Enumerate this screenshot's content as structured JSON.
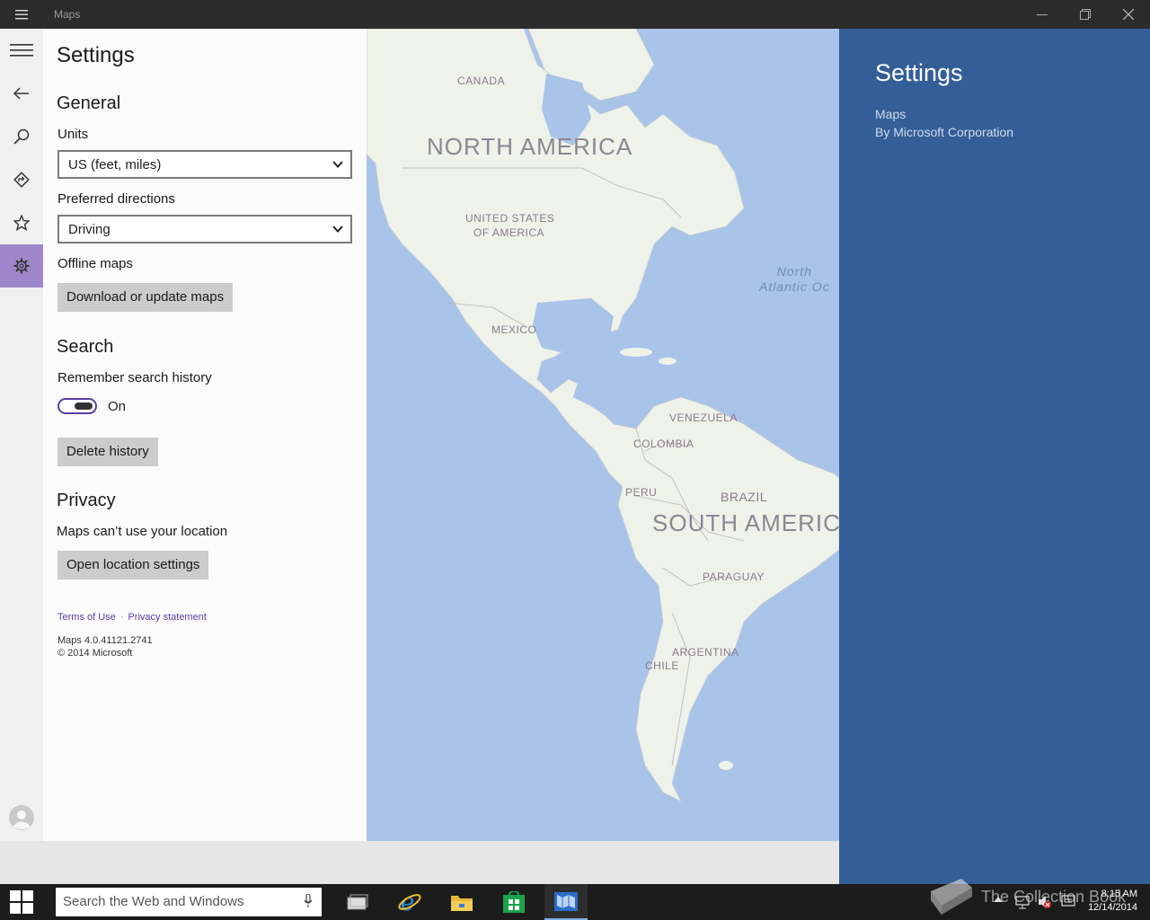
{
  "window": {
    "title": "Maps"
  },
  "settings": {
    "title": "Settings",
    "general": {
      "heading": "General",
      "units_label": "Units",
      "units_value": "US (feet, miles)",
      "directions_label": "Preferred directions",
      "directions_value": "Driving",
      "offline_label": "Offline maps",
      "download_button": "Download or update maps"
    },
    "search": {
      "heading": "Search",
      "history_label": "Remember search history",
      "toggle_state": "On",
      "delete_button": "Delete history"
    },
    "privacy": {
      "heading": "Privacy",
      "location_text": "Maps can’t use your location",
      "location_button": "Open location settings"
    },
    "links": {
      "terms": "Terms of Use",
      "sep": "·",
      "privacy": "Privacy statement"
    },
    "version": "Maps 4.0.41121.2741",
    "copyright": "© 2014 Microsoft"
  },
  "map_labels": {
    "canada": "CANADA",
    "north_america": "NORTH AMERICA",
    "usa_1": "UNITED STATES",
    "usa_2": "OF AMERICA",
    "mexico": "MEXICO",
    "venezuela": "VENEZUELA",
    "colombia": "COLOMBIA",
    "peru": "PERU",
    "brazil": "BRAZIL",
    "south_america": "SOUTH AMERICA",
    "paraguay": "PARAGUAY",
    "argentina": "ARGENTINA",
    "chile": "CHILE",
    "ocean_1": "North",
    "ocean_2": "Atlantic Oc"
  },
  "charm": {
    "title": "Settings",
    "app": "Maps",
    "publisher": "By Microsoft Corporation"
  },
  "taskbar": {
    "search_placeholder": "Search the Web and Windows",
    "time": "8:15 AM",
    "date": "12/14/2014",
    "watermark": "The Collection Book"
  },
  "colors": {
    "accent": "#9d86c9",
    "charm_bg": "#345e97",
    "map_water": "#a9c4e9",
    "map_land": "#eef2e8"
  }
}
